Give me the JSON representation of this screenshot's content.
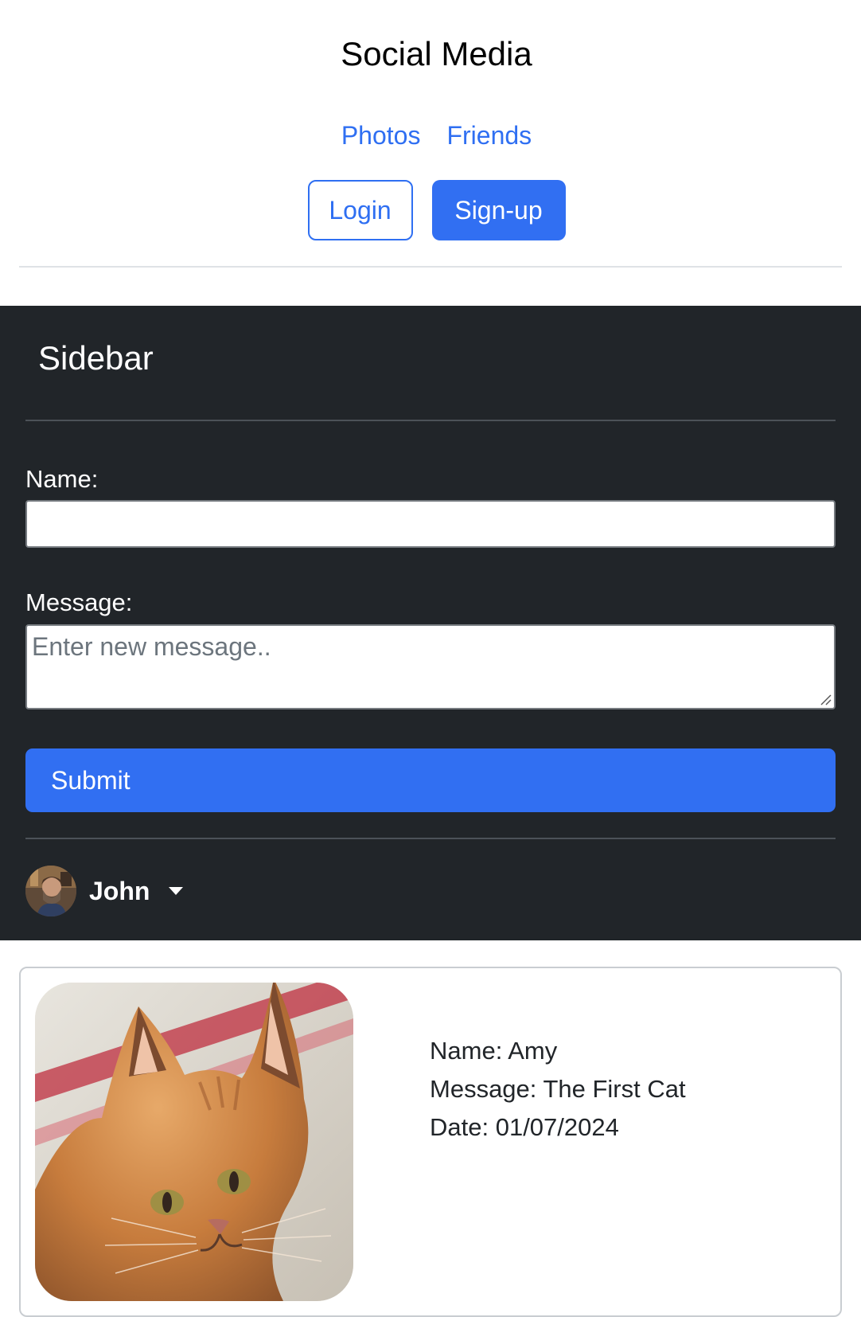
{
  "header": {
    "title": "Social Media",
    "nav": [
      "Photos",
      "Friends"
    ],
    "login_label": "Login",
    "signup_label": "Sign-up"
  },
  "sidebar": {
    "title": "Sidebar",
    "name_label": "Name:",
    "name_value": "",
    "message_label": "Message:",
    "message_placeholder": "Enter new message..",
    "submit_label": "Submit",
    "user": {
      "name": "John",
      "avatar_icon": "user-avatar"
    }
  },
  "post": {
    "photo_icon": "orange-cat-photo",
    "name": "Name: Amy",
    "message": "Message: The First Cat",
    "date": "Date: 01/07/2024"
  },
  "colors": {
    "primary": "#316ff2",
    "sidebar_bg": "#212529",
    "link": "#2f6ff2"
  }
}
